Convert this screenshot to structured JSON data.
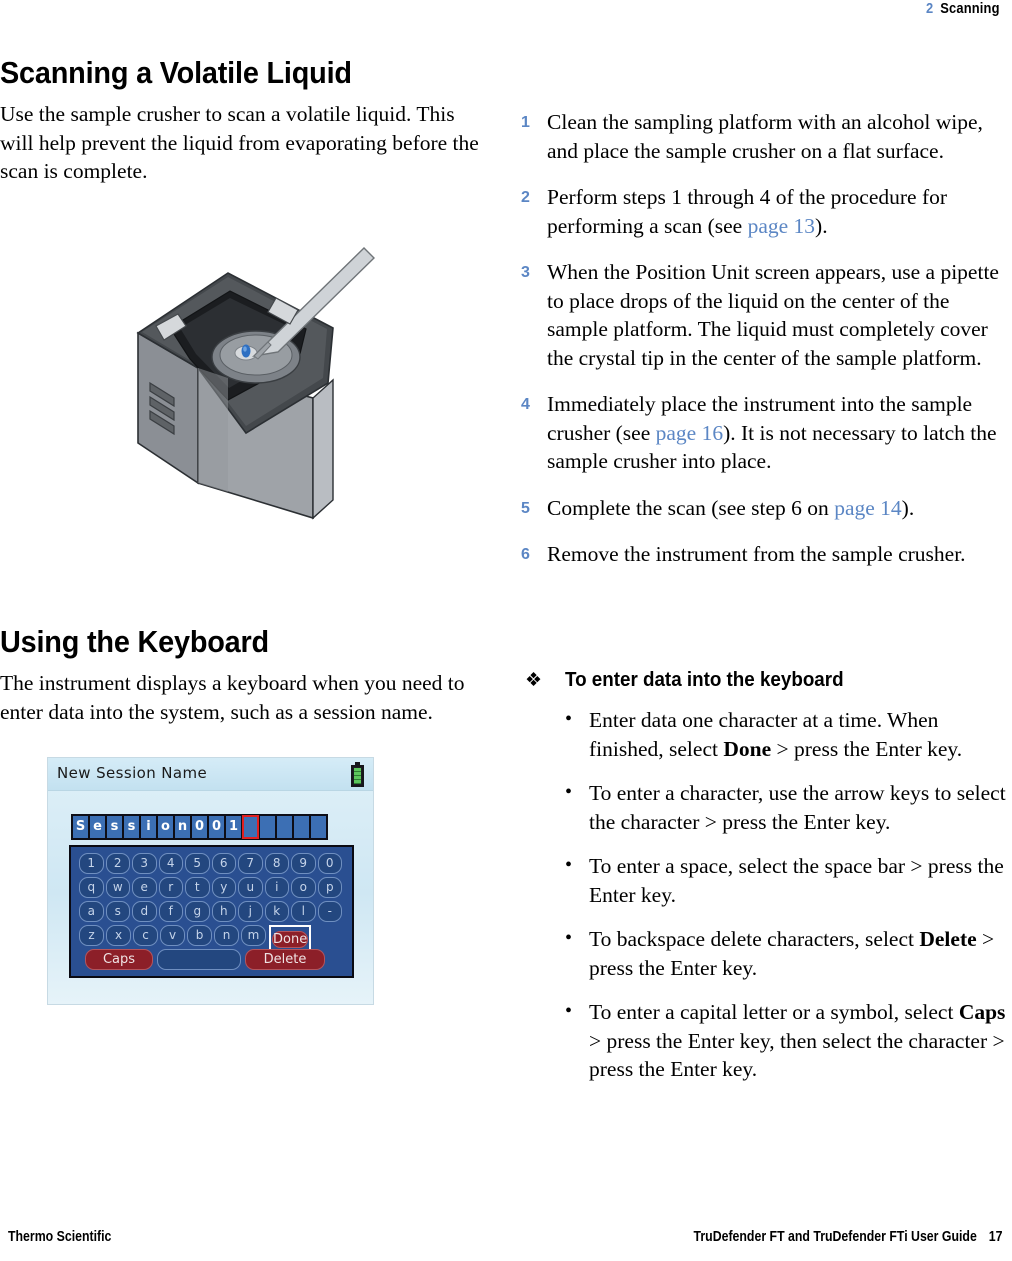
{
  "header": {
    "chapter_number": "2",
    "chapter_title": "Scanning"
  },
  "left_column": {
    "section1": {
      "title": "Scanning a Volatile Liquid",
      "intro": "Use the sample crusher to scan a volatile liquid. This will help prevent the liquid from evaporating before the scan is complete.",
      "figure_caption": "sample-crusher-with-pipette"
    },
    "section2": {
      "title": "Using the Keyboard",
      "intro": "The instrument displays a keyboard when you need to enter data into the system, such as a session name."
    }
  },
  "device_screen": {
    "title": "New Session Name",
    "battery_icon": "battery-full-icon",
    "entry_value": "Session001",
    "entry_total_cells": 15,
    "cursor_index": 10,
    "keyboard_rows": [
      [
        "1",
        "2",
        "3",
        "4",
        "5",
        "6",
        "7",
        "8",
        "9",
        "0"
      ],
      [
        "q",
        "w",
        "e",
        "r",
        "t",
        "y",
        "u",
        "i",
        "o",
        "p"
      ],
      [
        "a",
        "s",
        "d",
        "f",
        "g",
        "h",
        "j",
        "k",
        "l",
        "-"
      ],
      [
        "z",
        "x",
        "c",
        "v",
        "b",
        "n",
        "m"
      ]
    ],
    "done_label": "Done",
    "caps_label": "Caps",
    "delete_label": "Delete",
    "selected_key": "Done"
  },
  "steps": [
    {
      "num": "1",
      "parts": [
        {
          "t": "Clean the sampling platform with an alcohol wipe, and place the sample crusher on a flat surface."
        }
      ]
    },
    {
      "num": "2",
      "parts": [
        {
          "t": "Perform steps 1 through 4 of the procedure for performing a scan (see "
        },
        {
          "t": "page 13",
          "link": true
        },
        {
          "t": ")."
        }
      ]
    },
    {
      "num": "3",
      "parts": [
        {
          "t": "When the Position Unit screen appears, use a pipette to place drops of the liquid on the center of the sample platform. The liquid must completely cover the crystal tip in the center of the sample platform."
        }
      ]
    },
    {
      "num": "4",
      "parts": [
        {
          "t": "Immediately place the instrument into the sample crusher (see "
        },
        {
          "t": "page 16",
          "link": true
        },
        {
          "t": "). It is not necessary to latch the sample crusher into place."
        }
      ]
    },
    {
      "num": "5",
      "parts": [
        {
          "t": "Complete the scan (see step 6 on "
        },
        {
          "t": "page 14",
          "link": true
        },
        {
          "t": ")."
        }
      ]
    },
    {
      "num": "6",
      "parts": [
        {
          "t": "Remove the instrument from the sample crusher."
        }
      ]
    }
  ],
  "procedure": {
    "bullet_glyph": "❖",
    "heading": "To enter data into the keyboard",
    "items": [
      {
        "parts": [
          {
            "t": "Enter data one character at a time. When finished, select "
          },
          {
            "t": "Done",
            "bold": true
          },
          {
            "t": " > press the Enter key."
          }
        ]
      },
      {
        "parts": [
          {
            "t": "To enter a character, use the arrow keys to select the character > press the Enter key."
          }
        ]
      },
      {
        "parts": [
          {
            "t": "To enter a space, select the space bar > press the Enter key."
          }
        ]
      },
      {
        "parts": [
          {
            "t": "To backspace delete characters, select "
          },
          {
            "t": "Delete",
            "bold": true
          },
          {
            "t": " > press the Enter key."
          }
        ]
      },
      {
        "parts": [
          {
            "t": "To enter a capital letter or a symbol, select "
          },
          {
            "t": "Caps",
            "bold": true
          },
          {
            "t": " > press the Enter key, then select the character > press the Enter key."
          }
        ]
      }
    ]
  },
  "footer": {
    "left": "Thermo Scientific",
    "right": "TruDefender FT and TruDefender FTi User Guide",
    "page_number": "17"
  },
  "colors": {
    "accent_blue": "#5b86c4",
    "keyboard_panel": "#2a4f91",
    "key_face": "#23477f",
    "key_red": "#8c1f28",
    "cursor_red": "#e02020",
    "battery_green": "#5cc65c",
    "screen_bg": "#dff0f8"
  }
}
